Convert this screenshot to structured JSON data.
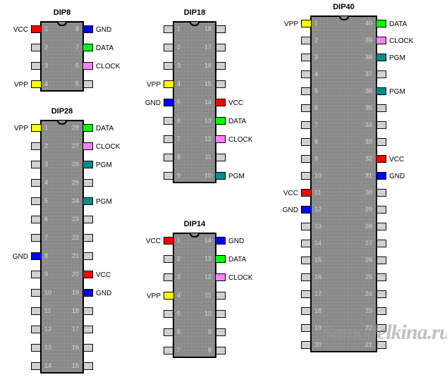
{
  "watermark": {
    "text": "Samodelkina.ru"
  },
  "colors": {
    "vpp": "#ffff00",
    "vcc": "#ff0000",
    "gnd": "#0000ff",
    "data": "#00ff00",
    "clock": "#ff80ff",
    "pgm": "#008c8c",
    "nc": "#c8c8c8",
    "body": "#8a8a8a",
    "outline": "#000000",
    "pin_number": "#d8d8d8",
    "label": "#000000"
  },
  "legend": {
    "signals": [
      "VPP",
      "VCC",
      "GND",
      "DATA",
      "CLOCK",
      "PGM"
    ]
  },
  "chips": [
    {
      "id": "dip8",
      "title": "DIP8",
      "pin_count": 8,
      "rows": 4,
      "left_pins": [
        {
          "num": "1",
          "label": "VCC",
          "signal": "vcc"
        },
        {
          "num": "2",
          "label": "",
          "signal": "nc"
        },
        {
          "num": "3",
          "label": "",
          "signal": "nc"
        },
        {
          "num": "4",
          "label": "VPP",
          "signal": "vpp"
        }
      ],
      "right_pins": [
        {
          "num": "8",
          "label": "GND",
          "signal": "gnd"
        },
        {
          "num": "7",
          "label": "DATA",
          "signal": "data"
        },
        {
          "num": "6",
          "label": "CLOCK",
          "signal": "clock"
        },
        {
          "num": "5",
          "label": "",
          "signal": "nc"
        }
      ]
    },
    {
      "id": "dip28",
      "title": "DIP28",
      "pin_count": 28,
      "rows": 14,
      "left_pins": [
        {
          "num": "1",
          "label": "VPP",
          "signal": "vpp"
        },
        {
          "num": "2",
          "label": "",
          "signal": "nc"
        },
        {
          "num": "3",
          "label": "",
          "signal": "nc"
        },
        {
          "num": "4",
          "label": "",
          "signal": "nc"
        },
        {
          "num": "5",
          "label": "",
          "signal": "nc"
        },
        {
          "num": "6",
          "label": "",
          "signal": "nc"
        },
        {
          "num": "7",
          "label": "",
          "signal": "nc"
        },
        {
          "num": "8",
          "label": "GND",
          "signal": "gnd"
        },
        {
          "num": "9",
          "label": "",
          "signal": "nc"
        },
        {
          "num": "10",
          "label": "",
          "signal": "nc"
        },
        {
          "num": "11",
          "label": "",
          "signal": "nc"
        },
        {
          "num": "12",
          "label": "",
          "signal": "nc"
        },
        {
          "num": "13",
          "label": "",
          "signal": "nc"
        },
        {
          "num": "14",
          "label": "",
          "signal": "nc"
        }
      ],
      "right_pins": [
        {
          "num": "28",
          "label": "DATA",
          "signal": "data"
        },
        {
          "num": "27",
          "label": "CLOCK",
          "signal": "clock"
        },
        {
          "num": "26",
          "label": "PGM",
          "signal": "pgm"
        },
        {
          "num": "25",
          "label": "",
          "signal": "nc"
        },
        {
          "num": "24",
          "label": "PGM",
          "signal": "pgm"
        },
        {
          "num": "23",
          "label": "",
          "signal": "nc"
        },
        {
          "num": "22",
          "label": "",
          "signal": "nc"
        },
        {
          "num": "21",
          "label": "",
          "signal": "nc"
        },
        {
          "num": "20",
          "label": "VCC",
          "signal": "vcc"
        },
        {
          "num": "19",
          "label": "GND",
          "signal": "gnd"
        },
        {
          "num": "18",
          "label": "",
          "signal": "nc"
        },
        {
          "num": "17",
          "label": "",
          "signal": "nc"
        },
        {
          "num": "16",
          "label": "",
          "signal": "nc"
        },
        {
          "num": "15",
          "label": "",
          "signal": "nc"
        }
      ]
    },
    {
      "id": "dip18",
      "title": "DIP18",
      "pin_count": 18,
      "rows": 9,
      "left_pins": [
        {
          "num": "1",
          "label": "",
          "signal": "nc"
        },
        {
          "num": "2",
          "label": "",
          "signal": "nc"
        },
        {
          "num": "3",
          "label": "",
          "signal": "nc"
        },
        {
          "num": "4",
          "label": "VPP",
          "signal": "vpp"
        },
        {
          "num": "5",
          "label": "GND",
          "signal": "gnd"
        },
        {
          "num": "6",
          "label": "",
          "signal": "nc"
        },
        {
          "num": "7",
          "label": "",
          "signal": "nc"
        },
        {
          "num": "8",
          "label": "",
          "signal": "nc"
        },
        {
          "num": "9",
          "label": "",
          "signal": "nc"
        }
      ],
      "right_pins": [
        {
          "num": "18",
          "label": "",
          "signal": "nc"
        },
        {
          "num": "17",
          "label": "",
          "signal": "nc"
        },
        {
          "num": "16",
          "label": "",
          "signal": "nc"
        },
        {
          "num": "15",
          "label": "",
          "signal": "nc"
        },
        {
          "num": "14",
          "label": "VCC",
          "signal": "vcc"
        },
        {
          "num": "13",
          "label": "DATA",
          "signal": "data"
        },
        {
          "num": "12",
          "label": "CLOCK",
          "signal": "clock"
        },
        {
          "num": "11",
          "label": "",
          "signal": "nc"
        },
        {
          "num": "10",
          "label": "PGM",
          "signal": "pgm"
        }
      ]
    },
    {
      "id": "dip14",
      "title": "DIP14",
      "pin_count": 14,
      "rows": 7,
      "left_pins": [
        {
          "num": "1",
          "label": "VCC",
          "signal": "vcc"
        },
        {
          "num": "2",
          "label": "",
          "signal": "nc"
        },
        {
          "num": "3",
          "label": "",
          "signal": "nc"
        },
        {
          "num": "4",
          "label": "VPP",
          "signal": "vpp"
        },
        {
          "num": "5",
          "label": "",
          "signal": "nc"
        },
        {
          "num": "6",
          "label": "",
          "signal": "nc"
        },
        {
          "num": "7",
          "label": "",
          "signal": "nc"
        }
      ],
      "right_pins": [
        {
          "num": "14",
          "label": "GND",
          "signal": "gnd"
        },
        {
          "num": "13",
          "label": "DATA",
          "signal": "data"
        },
        {
          "num": "12",
          "label": "CLOCK",
          "signal": "clock"
        },
        {
          "num": "11",
          "label": "",
          "signal": "nc"
        },
        {
          "num": "10",
          "label": "",
          "signal": "nc"
        },
        {
          "num": "9",
          "label": "",
          "signal": "nc"
        },
        {
          "num": "8",
          "label": "",
          "signal": "nc"
        }
      ]
    },
    {
      "id": "dip40",
      "title": "DIP40",
      "pin_count": 40,
      "rows": 20,
      "left_pins": [
        {
          "num": "1",
          "label": "VPP",
          "signal": "vpp"
        },
        {
          "num": "2",
          "label": "",
          "signal": "nc"
        },
        {
          "num": "3",
          "label": "",
          "signal": "nc"
        },
        {
          "num": "4",
          "label": "",
          "signal": "nc"
        },
        {
          "num": "5",
          "label": "",
          "signal": "nc"
        },
        {
          "num": "6",
          "label": "",
          "signal": "nc"
        },
        {
          "num": "7",
          "label": "",
          "signal": "nc"
        },
        {
          "num": "8",
          "label": "",
          "signal": "nc"
        },
        {
          "num": "9",
          "label": "",
          "signal": "nc"
        },
        {
          "num": "10",
          "label": "",
          "signal": "nc"
        },
        {
          "num": "11",
          "label": "VCC",
          "signal": "vcc"
        },
        {
          "num": "12",
          "label": "GND",
          "signal": "gnd"
        },
        {
          "num": "13",
          "label": "",
          "signal": "nc"
        },
        {
          "num": "14",
          "label": "",
          "signal": "nc"
        },
        {
          "num": "15",
          "label": "",
          "signal": "nc"
        },
        {
          "num": "16",
          "label": "",
          "signal": "nc"
        },
        {
          "num": "17",
          "label": "",
          "signal": "nc"
        },
        {
          "num": "18",
          "label": "",
          "signal": "nc"
        },
        {
          "num": "19",
          "label": "",
          "signal": "nc"
        },
        {
          "num": "20",
          "label": "",
          "signal": "nc"
        }
      ],
      "right_pins": [
        {
          "num": "40",
          "label": "DATA",
          "signal": "data"
        },
        {
          "num": "39",
          "label": "CLOCK",
          "signal": "clock"
        },
        {
          "num": "38",
          "label": "PGM",
          "signal": "pgm"
        },
        {
          "num": "37",
          "label": "",
          "signal": "nc"
        },
        {
          "num": "36",
          "label": "PGM",
          "signal": "pgm"
        },
        {
          "num": "35",
          "label": "",
          "signal": "nc"
        },
        {
          "num": "34",
          "label": "",
          "signal": "nc"
        },
        {
          "num": "33",
          "label": "",
          "signal": "nc"
        },
        {
          "num": "32",
          "label": "VCC",
          "signal": "vcc"
        },
        {
          "num": "31",
          "label": "GND",
          "signal": "gnd"
        },
        {
          "num": "30",
          "label": "",
          "signal": "nc"
        },
        {
          "num": "29",
          "label": "",
          "signal": "nc"
        },
        {
          "num": "28",
          "label": "",
          "signal": "nc"
        },
        {
          "num": "27",
          "label": "",
          "signal": "nc"
        },
        {
          "num": "26",
          "label": "",
          "signal": "nc"
        },
        {
          "num": "25",
          "label": "",
          "signal": "nc"
        },
        {
          "num": "24",
          "label": "",
          "signal": "nc"
        },
        {
          "num": "23",
          "label": "",
          "signal": "nc"
        },
        {
          "num": "22",
          "label": "",
          "signal": "nc"
        },
        {
          "num": "21",
          "label": "",
          "signal": "nc"
        }
      ]
    }
  ]
}
